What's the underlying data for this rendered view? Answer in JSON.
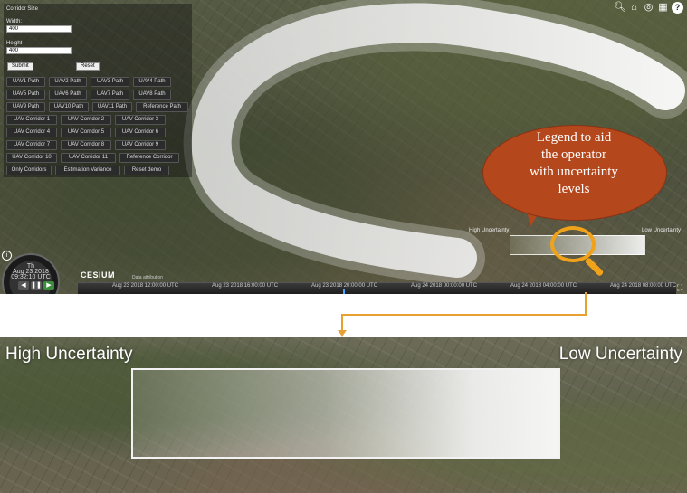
{
  "panel": {
    "title": "Corridor Size",
    "width_label": "Width:",
    "width_value": "400",
    "height_label": "Height",
    "height_value": "400",
    "submit_label": "Submit",
    "reset_label": "Reset",
    "buttons": [
      "UAV1 Path",
      "UAV2 Path",
      "UAV3 Path",
      "UAV4 Path",
      "UAV5 Path",
      "UAV6 Path",
      "UAV7 Path",
      "UAV8 Path",
      "UAV9 Path",
      "UAV10 Path",
      "UAV11 Path",
      "Reference Path",
      "UAV Corridor 1",
      "UAV Corridor 2",
      "UAV Corridor 3",
      "UAV Corridor 4",
      "UAV Corridor 5",
      "UAV Corridor 6",
      "UAV Corridor 7",
      "UAV Corridor 8",
      "UAV Corridor 9",
      "UAV Corridor 10",
      "UAV Corridor 11",
      "Reference Corridor",
      "Only Corridors",
      "Estimation Variance",
      "Reset demo"
    ]
  },
  "toolbar": {
    "icons": [
      "search-icon",
      "home-icon",
      "globe-icon",
      "grid-icon",
      "help-icon"
    ],
    "help_glyph": "?"
  },
  "callout": {
    "text_lines": [
      "Legend to aid",
      "the operator",
      "with uncertainty",
      "levels"
    ],
    "color": "#b5471c"
  },
  "legend": {
    "high_label": "High Uncertainty",
    "low_label": "Low Uncertainty"
  },
  "clock": {
    "day": "Th",
    "date": "Aug 23 2018",
    "time": "09:32:10 UTC"
  },
  "brand": {
    "name": "CESIUM",
    "sub": "Data attribution"
  },
  "timeline": {
    "ticks": [
      "Aug 23 2018 12:00:00 UTC",
      "Aug 23 2018 16:00:00 UTC",
      "Aug 23 2018 20:00:00 UTC",
      "Aug 24 2018 00:00:00 UTC",
      "Aug 24 2018 04:00:00 UTC",
      "Aug 24 2018 08:00:00 UTC"
    ]
  },
  "zoom": {
    "high_label": "High Uncertainty",
    "low_label": "Low Uncertainty"
  },
  "colors": {
    "accent": "#e8a030",
    "callout": "#b5471c"
  }
}
